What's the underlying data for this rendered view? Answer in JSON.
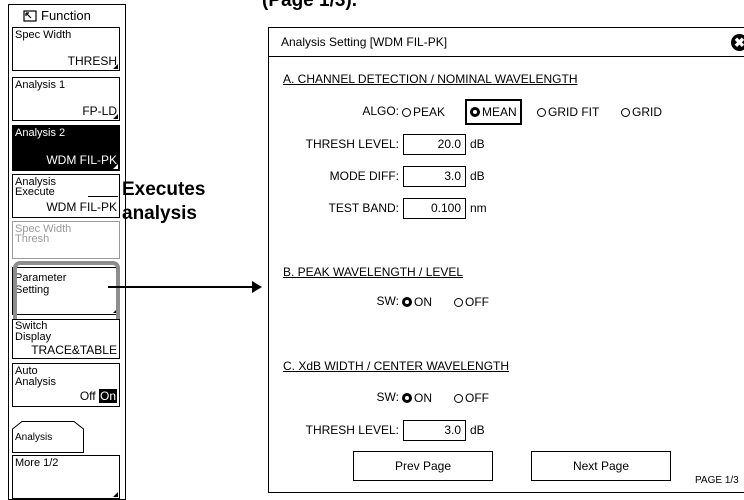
{
  "heading": "(Page 1/3).",
  "softkeys": {
    "title": "Function",
    "keys": [
      {
        "line1": "Spec Width",
        "value": "THRESH"
      },
      {
        "line1": "Analysis 1",
        "value": "FP-LD"
      },
      {
        "line1": "Analysis 2",
        "value": "WDM FIL-PK"
      },
      {
        "line1": "Analysis",
        "line2": "Execute",
        "value": "WDM FIL-PK"
      },
      {
        "line1": "Spec Width",
        "line2": "Thresh"
      },
      {
        "line1": "Parameter",
        "line2": "Setting"
      },
      {
        "line1": "Switch",
        "line2": "Display",
        "value": "TRACE&TABLE"
      },
      {
        "line1": "Auto",
        "line2": "Analysis",
        "off": "Off",
        "on": "On"
      },
      {
        "line1": "Analysis"
      },
      {
        "line1": "More 1/2"
      }
    ]
  },
  "callout": {
    "line1": "Executes",
    "line2": "analysis"
  },
  "dialog": {
    "title": "Analysis Setting [WDM FIL-PK]",
    "close_glyph": "✖",
    "section_a": {
      "heading": "A. CHANNEL DETECTION / NOMINAL WAVELENGTH",
      "algo_label": "ALGO:",
      "algo_options": [
        "PEAK",
        "MEAN",
        "GRID FIT",
        "GRID"
      ],
      "algo_selected": "MEAN",
      "thresh_label": "THRESH LEVEL:",
      "thresh_value": "20.0",
      "thresh_unit": "dB",
      "mode_label": "MODE DIFF:",
      "mode_value": "3.0",
      "mode_unit": "dB",
      "band_label": "TEST BAND:",
      "band_value": "0.100",
      "band_unit": "nm"
    },
    "section_b": {
      "heading": "B. PEAK WAVELENGTH / LEVEL",
      "sw_label": "SW:",
      "on": "ON",
      "off": "OFF",
      "selected": "ON"
    },
    "section_c": {
      "heading": "C. XdB WIDTH / CENTER WAVELENGTH",
      "sw_label": "SW:",
      "on": "ON",
      "off": "OFF",
      "selected": "ON",
      "thresh_label": "THRESH LEVEL:",
      "thresh_value": "3.0",
      "thresh_unit": "dB"
    },
    "prev_page": "Prev Page",
    "next_page": "Next Page",
    "page_indicator": "PAGE 1/3"
  }
}
